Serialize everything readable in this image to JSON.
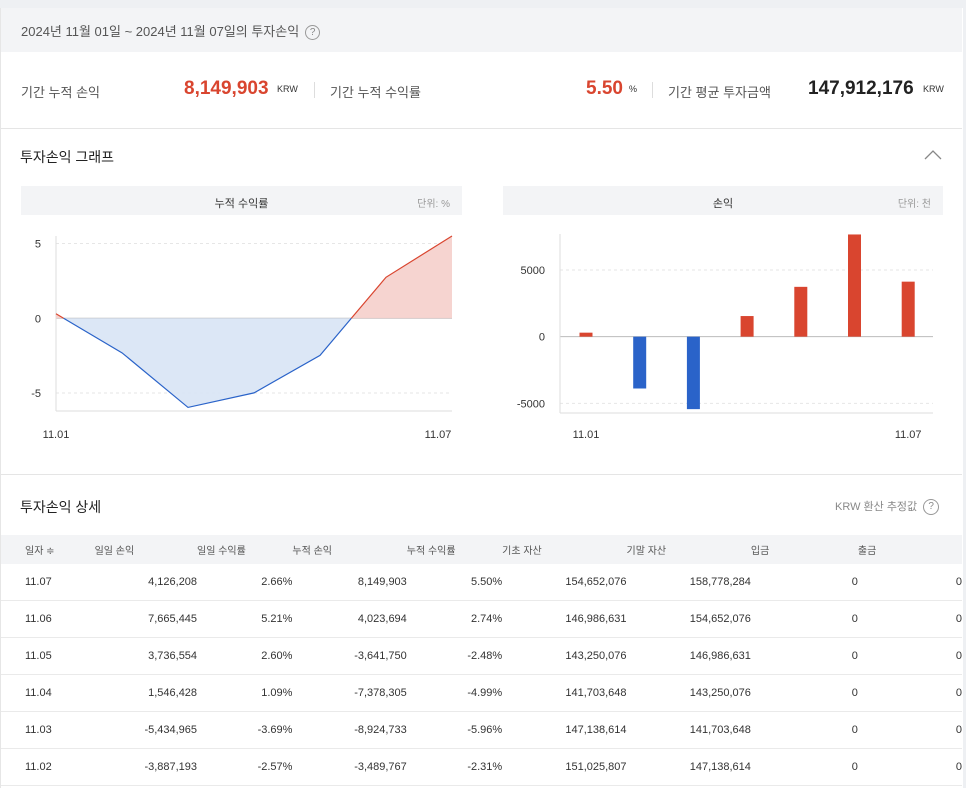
{
  "header": {
    "range_text": "2024년 11월 01일 ~ 2024년 11월 07일의 투자손익",
    "help_icon": "?"
  },
  "summary": {
    "cum_profit_label": "기간 누적 손익",
    "cum_profit_value": "8,149,903",
    "cum_profit_unit": "KRW",
    "cum_return_label": "기간 누적 수익률",
    "cum_return_value": "5.50",
    "cum_return_unit": "%",
    "avg_invest_label": "기간 평균 투자금액",
    "avg_invest_value": "147,912,176",
    "avg_invest_unit": "KRW"
  },
  "graph_section": {
    "title": "투자손익 그래프",
    "collapse_icon": "chevron-up-icon"
  },
  "chart_data": [
    {
      "type": "area",
      "title": "누적 수익률",
      "unit_label": "단위: %",
      "x": [
        "11.01",
        "11.02",
        "11.03",
        "11.04",
        "11.05",
        "11.06",
        "11.07"
      ],
      "x_tick_labels": [
        "11.01",
        "11.07"
      ],
      "values": [
        0.3,
        -2.31,
        -5.96,
        -4.99,
        -2.48,
        2.74,
        5.5
      ],
      "yticks": [
        5,
        0,
        -5
      ],
      "ylim": [
        -6,
        5.5
      ],
      "colors": {
        "positive": "#d9452f",
        "negative": "#2a63c9"
      },
      "grid": true
    },
    {
      "type": "bar",
      "title": "손익",
      "unit_label": "단위: 천",
      "x": [
        "11.01",
        "11.02",
        "11.03",
        "11.04",
        "11.05",
        "11.06",
        "11.07"
      ],
      "x_tick_labels": [
        "11.01",
        "11.07"
      ],
      "values": [
        300,
        -3887,
        -5435,
        1546,
        3737,
        7665,
        4126
      ],
      "yticks": [
        5000,
        0,
        -5000
      ],
      "ylim": [
        -5500,
        7700
      ],
      "colors": {
        "positive": "#d9452f",
        "negative": "#2a63c9"
      },
      "grid": true
    }
  ],
  "detail_section": {
    "title": "투자손익 상세",
    "note": "KRW 환산 추정값",
    "columns": [
      "일자 ≑",
      "일일 손익",
      "일일 수익률",
      "누적 손익",
      "누적 수익률",
      "기초 자산",
      "기말 자산",
      "입금",
      "출금"
    ],
    "rows": [
      [
        "11.07",
        "4,126,208",
        "2.66%",
        "8,149,903",
        "5.50%",
        "154,652,076",
        "158,778,284",
        "0",
        "0"
      ],
      [
        "11.06",
        "7,665,445",
        "5.21%",
        "4,023,694",
        "2.74%",
        "146,986,631",
        "154,652,076",
        "0",
        "0"
      ],
      [
        "11.05",
        "3,736,554",
        "2.60%",
        "-3,641,750",
        "-2.48%",
        "143,250,076",
        "146,986,631",
        "0",
        "0"
      ],
      [
        "11.04",
        "1,546,428",
        "1.09%",
        "-7,378,305",
        "-4.99%",
        "141,703,648",
        "143,250,076",
        "0",
        "0"
      ],
      [
        "11.03",
        "-5,434,965",
        "-3.69%",
        "-8,924,733",
        "-5.96%",
        "147,138,614",
        "141,703,648",
        "0",
        "0"
      ],
      [
        "11.02",
        "-3,887,193",
        "-2.57%",
        "-3,489,767",
        "-2.31%",
        "151,025,807",
        "147,138,614",
        "0",
        "0"
      ]
    ]
  }
}
